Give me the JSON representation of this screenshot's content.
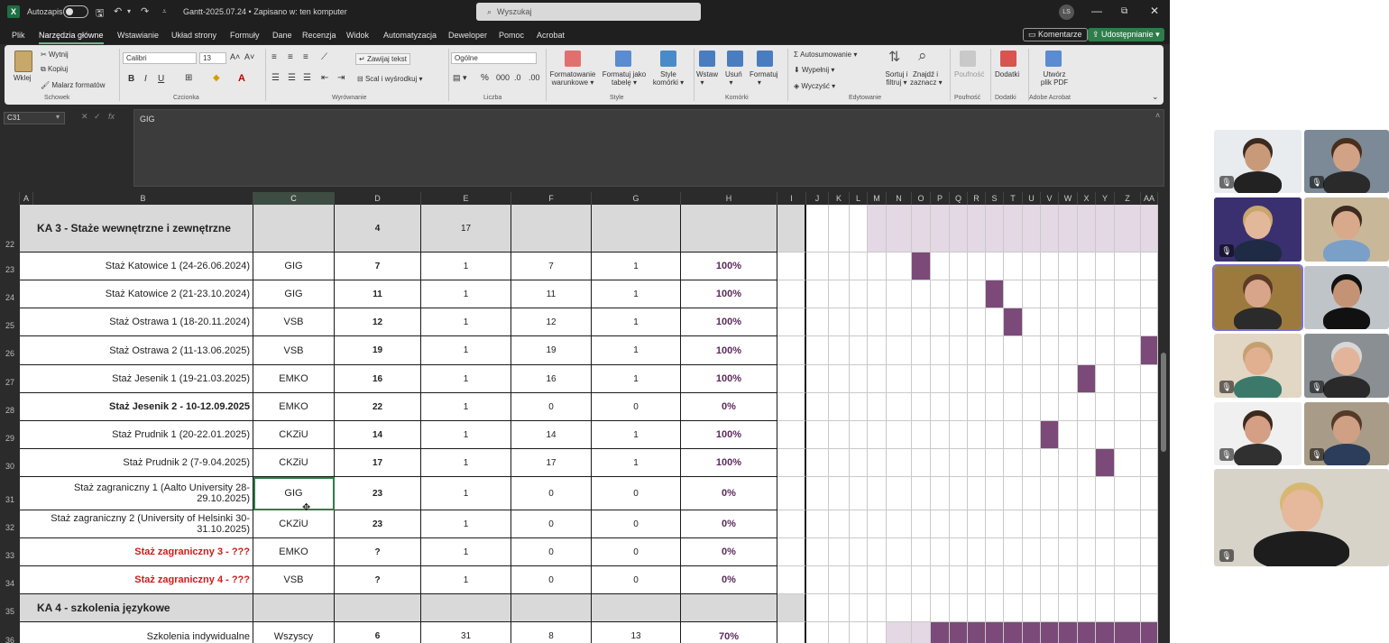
{
  "titlebar": {
    "autosave_label": "Autozapis",
    "document_title": "Gantt-2025.07.24 • Zapisano w: ten komputer",
    "search_placeholder": "Wyszukaj",
    "user_initials": "LS",
    "minimize": "—",
    "restore": "⧉",
    "close": "✕"
  },
  "menu": {
    "tabs": [
      "Plik",
      "Narzędzia główne",
      "Wstawianie",
      "Układ strony",
      "Formuły",
      "Dane",
      "Recenzja",
      "Widok",
      "Automatyzacja",
      "Deweloper",
      "Pomoc",
      "Acrobat"
    ],
    "active_tab": "Narzędzia główne",
    "comments_label": "Komentarze",
    "share_label": "Udostępnianie"
  },
  "ribbon": {
    "paste_label": "Wklej",
    "cut_label": "Wytnij",
    "copy_label": "Kopiuj",
    "format_painter_label": "Malarz formatów",
    "clipboard_section": "Schowek",
    "font_name": "Calibri",
    "font_size": "13",
    "font_section": "Czcionka",
    "wrap_text_label": "Zawijaj tekst",
    "merge_label": "Scal i wyśrodkuj",
    "alignment_section": "Wyrównanie",
    "number_format": "Ogólne",
    "number_section": "Liczba",
    "cond_format_label_1": "Formatowanie",
    "cond_format_label_2": "warunkowe",
    "format_table_label_1": "Formatuj jako",
    "format_table_label_2": "tabelę",
    "cell_styles_label_1": "Style",
    "cell_styles_label_2": "komórki",
    "styles_section": "Style",
    "insert_label": "Wstaw",
    "delete_label": "Usuń",
    "format_label": "Formatuj",
    "cells_section": "Komórki",
    "autosum_label": "Autosumowanie",
    "fill_label": "Wypełnij",
    "clear_label": "Wyczyść",
    "sort_label_1": "Sortuj i",
    "sort_label_2": "filtruj",
    "find_label_1": "Znajdź i",
    "find_label_2": "zaznacz",
    "editing_section": "Edytowanie",
    "sensitivity_label": "Poufność",
    "sensitivity_section": "Poufność",
    "addins_label": "Dodatki",
    "addins_section": "Dodatki",
    "pdf_label_1": "Utwórz",
    "pdf_label_2": "plik PDF",
    "acrobat_section": "Adobe Acrobat"
  },
  "formula_bar": {
    "name_box": "C31",
    "fx_label": "fx",
    "formula": "GIG"
  },
  "columns": [
    "A",
    "B",
    "C",
    "D",
    "E",
    "F",
    "G",
    "H",
    "I",
    "J",
    "K",
    "L",
    "M",
    "N",
    "O",
    "P",
    "Q",
    "R",
    "S",
    "T",
    "U",
    "V",
    "W",
    "X",
    "Y",
    "Z",
    "AA"
  ],
  "selected_column": "C",
  "rows": [
    {
      "num": "22",
      "name": "KA 3 - Staże wewnętrzne i zewnętrzne",
      "partner": "",
      "d": "4",
      "e": "17",
      "f": "",
      "g": "",
      "h": "",
      "style": "header",
      "gantt_light": [
        15,
        16,
        17,
        18,
        19,
        20,
        21,
        22,
        23,
        24,
        25
      ],
      "gantt_bar": []
    },
    {
      "num": "23",
      "name": "Staż Katowice 1 (24-26.06.2024)",
      "partner": "GIG",
      "d": "7",
      "e": "1",
      "f": "7",
      "g": "1",
      "h": "100%",
      "style": "normal",
      "gantt_bar": [
        14
      ]
    },
    {
      "num": "24",
      "name": "Staż Katowice 2 (21-23.10.2024)",
      "partner": "GIG",
      "d": "11",
      "e": "1",
      "f": "11",
      "g": "1",
      "h": "100%",
      "style": "normal",
      "gantt_bar": [
        18
      ]
    },
    {
      "num": "25",
      "name": "Staż Ostrawa 1 (18-20.11.2024)",
      "partner": "VSB",
      "d": "12",
      "e": "1",
      "f": "12",
      "g": "1",
      "h": "100%",
      "style": "normal",
      "gantt_bar": [
        19
      ]
    },
    {
      "num": "26",
      "name": "Staż Ostrawa 2 (11-13.06.2025)",
      "partner": "VSB",
      "d": "19",
      "e": "1",
      "f": "19",
      "g": "1",
      "h": "100%",
      "style": "normal",
      "gantt_bar": [
        26
      ]
    },
    {
      "num": "27",
      "name": "Staż Jesenik 1 (19-21.03.2025)",
      "partner": "EMKO",
      "d": "16",
      "e": "1",
      "f": "16",
      "g": "1",
      "h": "100%",
      "style": "normal",
      "gantt_bar": [
        23
      ]
    },
    {
      "num": "28",
      "name": "Staż Jesenik 2 - 10-12.09.2025",
      "partner": "EMKO",
      "d": "22",
      "e": "1",
      "f": "0",
      "g": "0",
      "h": "0%",
      "style": "bold",
      "gantt_bar": []
    },
    {
      "num": "29",
      "name": "Staż Prudnik 1 (20-22.01.2025)",
      "partner": "CKZiU",
      "d": "14",
      "e": "1",
      "f": "14",
      "g": "1",
      "h": "100%",
      "style": "normal",
      "gantt_bar": [
        21
      ]
    },
    {
      "num": "30",
      "name": "Staż Prudnik 2 (7-9.04.2025)",
      "partner": "CKZiU",
      "d": "17",
      "e": "1",
      "f": "17",
      "g": "1",
      "h": "100%",
      "style": "normal",
      "gantt_bar": [
        24
      ]
    },
    {
      "num": "31",
      "name": "Staż zagraniczny 1 (Aalto University 28-29.10.2025)",
      "partner": "GIG",
      "d": "23",
      "e": "1",
      "f": "0",
      "g": "0",
      "h": "0%",
      "style": "normal",
      "gantt_bar": [],
      "selected": true
    },
    {
      "num": "32",
      "name": "Staż zagraniczny 2 (University of Helsinki 30-31.10.2025)",
      "partner": "CKZiU",
      "d": "23",
      "e": "1",
      "f": "0",
      "g": "0",
      "h": "0%",
      "style": "normal",
      "gantt_bar": []
    },
    {
      "num": "33",
      "name": "Staż zagraniczny 3 - ???",
      "partner": "EMKO",
      "d": "?",
      "e": "1",
      "f": "0",
      "g": "0",
      "h": "0%",
      "style": "red",
      "gantt_bar": []
    },
    {
      "num": "34",
      "name": "Staż zagraniczny 4 - ???",
      "partner": "VSB",
      "d": "?",
      "e": "1",
      "f": "0",
      "g": "0",
      "h": "0%",
      "style": "red",
      "gantt_bar": []
    },
    {
      "num": "35",
      "name": "KA 4 - szkolenia językowe",
      "partner": "",
      "d": "",
      "e": "",
      "f": "",
      "g": "",
      "h": "",
      "style": "header",
      "gantt_bar": []
    },
    {
      "num": "36",
      "name": "Szkolenia indywidualne",
      "partner": "Wszyscy",
      "d": "6",
      "e": "31",
      "f": "8",
      "g": "13",
      "h": "70%",
      "style": "normal",
      "gantt_light": [
        13,
        14
      ],
      "gantt_bar": [
        15,
        16,
        17,
        18,
        19,
        20,
        21,
        22,
        23,
        24,
        25,
        26
      ]
    }
  ],
  "colors": {
    "gantt_bar": "#7b4a78",
    "gantt_light": "#e4d8e4",
    "header_fill": "#d9d9d9",
    "percent_text": "#5d2a5d",
    "red_text": "#d11a1a",
    "excel_green": "#2f7d4a"
  },
  "participants": [
    {
      "id": "p1",
      "muted": true
    },
    {
      "id": "p2",
      "muted": true
    },
    {
      "id": "p3",
      "muted": true
    },
    {
      "id": "p4",
      "muted": false
    },
    {
      "id": "p5",
      "muted": false,
      "speaking": true
    },
    {
      "id": "p6",
      "muted": false
    },
    {
      "id": "p7",
      "muted": true
    },
    {
      "id": "p8",
      "muted": true
    },
    {
      "id": "p9",
      "muted": true
    },
    {
      "id": "p10",
      "muted": true
    },
    {
      "id": "p11",
      "muted": true
    }
  ]
}
